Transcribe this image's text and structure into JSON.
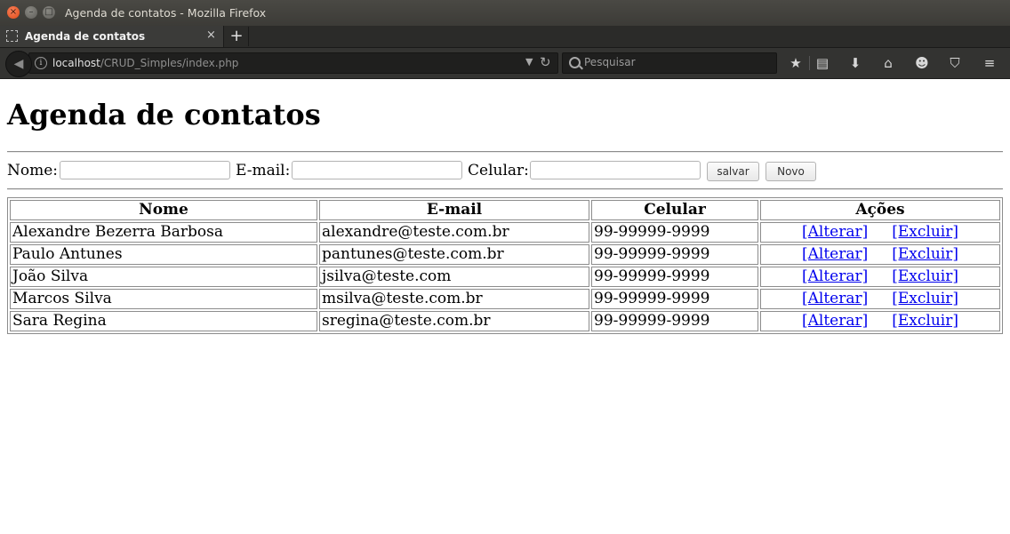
{
  "window": {
    "title": "Agenda de contatos - Mozilla Firefox"
  },
  "tab": {
    "title": "Agenda de contatos",
    "close_glyph": "×",
    "new_tab_glyph": "+"
  },
  "url": {
    "host": "localhost",
    "path": "/CRUD_Simples/index.php"
  },
  "search": {
    "placeholder": "Pesquisar"
  },
  "page": {
    "heading": "Agenda de contatos"
  },
  "form": {
    "nome_label": "Nome:",
    "email_label": "E-mail:",
    "celular_label": "Celular:",
    "salvar_label": "salvar",
    "novo_label": "Novo"
  },
  "table": {
    "headers": [
      "Nome",
      "E-mail",
      "Celular",
      "Ações"
    ],
    "rows": [
      {
        "nome": "Alexandre Bezerra Barbosa",
        "email": "alexandre@teste.com.br",
        "celular": "99-99999-9999",
        "alterar": "[Alterar]",
        "excluir": "[Excluir]"
      },
      {
        "nome": "Paulo Antunes",
        "email": "pantunes@teste.com.br",
        "celular": "99-99999-9999",
        "alterar": "[Alterar]",
        "excluir": "[Excluir]"
      },
      {
        "nome": "João Silva",
        "email": "jsilva@teste.com",
        "celular": "99-99999-9999",
        "alterar": "[Alterar]",
        "excluir": "[Excluir]"
      },
      {
        "nome": "Marcos Silva",
        "email": "msilva@teste.com.br",
        "celular": "99-99999-9999",
        "alterar": "[Alterar]",
        "excluir": "[Excluir]"
      },
      {
        "nome": "Sara Regina",
        "email": "sregina@teste.com.br",
        "celular": "99-99999-9999",
        "alterar": "[Alterar]",
        "excluir": "[Excluir]"
      }
    ]
  },
  "colors": {
    "link": "#0000ee",
    "titlebar": "#3c3b37",
    "close_button": "#df4a16"
  }
}
